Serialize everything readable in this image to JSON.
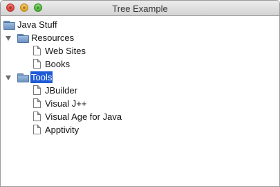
{
  "window": {
    "title": "Tree Example"
  },
  "tree": {
    "root": {
      "label": "Java Stuff",
      "icon": "folder-icon"
    },
    "nodes": [
      {
        "label": "Resources",
        "icon": "folder-icon",
        "expanded": true,
        "selected": false,
        "children": [
          {
            "label": "Web Sites",
            "icon": "document-icon"
          },
          {
            "label": "Books",
            "icon": "document-icon"
          }
        ]
      },
      {
        "label": "Tools",
        "icon": "folder-icon",
        "expanded": true,
        "selected": true,
        "children": [
          {
            "label": "JBuilder",
            "icon": "document-icon"
          },
          {
            "label": "Visual J++",
            "icon": "document-icon"
          },
          {
            "label": "Visual Age for Java",
            "icon": "document-icon"
          },
          {
            "label": "Apptivity",
            "icon": "document-icon"
          }
        ]
      }
    ]
  },
  "colors": {
    "selection": "#1f5bd6",
    "folder": "#7c9ec5"
  }
}
